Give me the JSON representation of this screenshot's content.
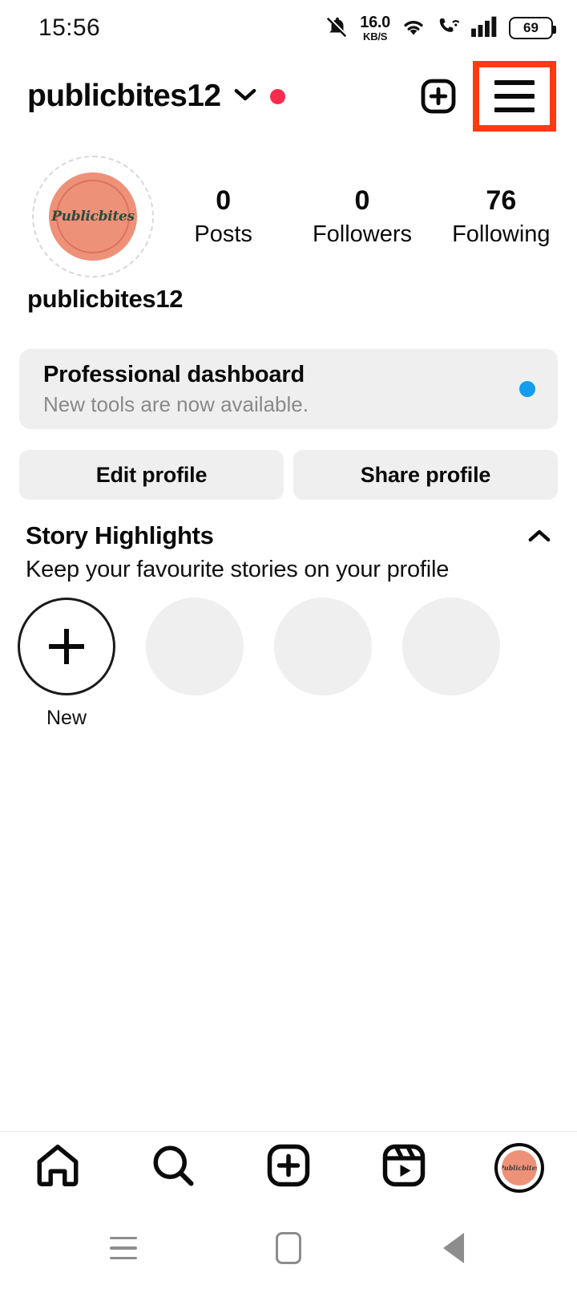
{
  "status_bar": {
    "time": "15:56",
    "mute_icon": "bell-muted-icon",
    "network_speed_value": "16.0",
    "network_speed_unit": "KB/S",
    "wifi_icon": "wifi-icon",
    "call_wifi_icon": "call-over-wifi-icon",
    "signal_icon": "cellular-signal-icon",
    "battery_level": "69"
  },
  "app_bar": {
    "username": "publicbites12",
    "chevron_icon": "chevron-down-icon",
    "notification_dot_color": "#FA2B4F",
    "create_icon": "plus-square-icon",
    "menu_icon": "hamburger-menu-icon",
    "highlight_color": "#FF3B0F"
  },
  "profile": {
    "avatar_logo_text": "Publicbites",
    "avatar_color": "#EE9179",
    "display_name": "publicbites12",
    "stats": [
      {
        "value": "0",
        "label": "Posts"
      },
      {
        "value": "0",
        "label": "Followers"
      },
      {
        "value": "76",
        "label": "Following"
      }
    ]
  },
  "dashboard": {
    "title": "Professional dashboard",
    "subtitle": "New tools are now available.",
    "dot_color": "#139EF2"
  },
  "actions": {
    "edit_profile": "Edit profile",
    "share_profile": "Share profile"
  },
  "story_highlights": {
    "title": "Story Highlights",
    "subtitle": "Keep your favourite stories on your profile",
    "collapse_icon": "chevron-up-icon",
    "new_label": "New",
    "placeholder_count": 3
  },
  "bottom_nav": {
    "items": [
      {
        "name": "home",
        "icon": "home-icon"
      },
      {
        "name": "search",
        "icon": "search-icon"
      },
      {
        "name": "create",
        "icon": "plus-square-icon"
      },
      {
        "name": "reels",
        "icon": "reels-icon"
      },
      {
        "name": "profile",
        "icon": "profile-avatar-icon"
      }
    ]
  },
  "system_nav": {
    "recent_icon": "recent-apps-icon",
    "home_icon": "system-home-icon",
    "back_icon": "system-back-icon"
  }
}
